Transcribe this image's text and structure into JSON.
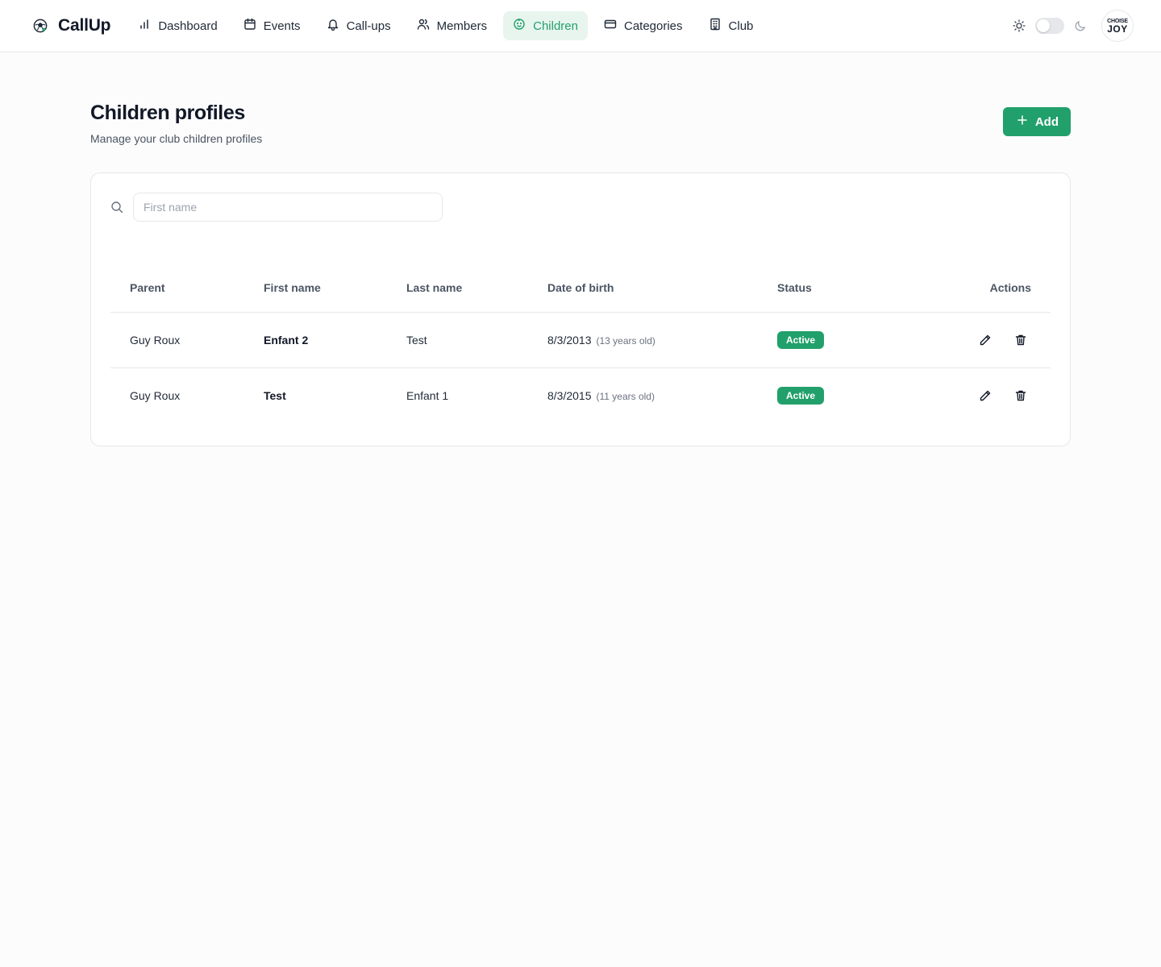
{
  "brand": {
    "name": "CallUp",
    "logo_icon": "soccer-ball-icon"
  },
  "nav": {
    "items": [
      {
        "label": "Dashboard",
        "icon": "bar-chart-icon",
        "active": false
      },
      {
        "label": "Events",
        "icon": "calendar-icon",
        "active": false
      },
      {
        "label": "Call-ups",
        "icon": "bell-icon",
        "active": false
      },
      {
        "label": "Members",
        "icon": "users-icon",
        "active": false
      },
      {
        "label": "Children",
        "icon": "baby-icon",
        "active": true
      },
      {
        "label": "Categories",
        "icon": "wallet-icon",
        "active": false
      },
      {
        "label": "Club",
        "icon": "building-icon",
        "active": false
      }
    ]
  },
  "header": {
    "theme_light_icon": "sun-icon",
    "theme_dark_icon": "moon-icon",
    "avatar_line1": "CHOISE",
    "avatar_line2": "JOY"
  },
  "page": {
    "title": "Children profiles",
    "subtitle": "Manage your club children profiles",
    "add_label": "Add"
  },
  "search": {
    "placeholder": "First name",
    "value": ""
  },
  "table": {
    "headers": {
      "parent": "Parent",
      "first_name": "First name",
      "last_name": "Last name",
      "dob": "Date of birth",
      "status": "Status",
      "actions": "Actions"
    },
    "rows": [
      {
        "parent": "Guy Roux",
        "first_name": "Enfant 2",
        "last_name": "Test",
        "dob": "8/3/2013",
        "age": "(13 years old)",
        "status": "Active"
      },
      {
        "parent": "Guy Roux",
        "first_name": "Test",
        "last_name": "Enfant 1",
        "dob": "8/3/2015",
        "age": "(11 years old)",
        "status": "Active"
      }
    ]
  },
  "colors": {
    "accent": "#22a06b",
    "accent_bg": "#e8f5ee",
    "border": "#e5e7eb",
    "muted_text": "#4b5563"
  }
}
